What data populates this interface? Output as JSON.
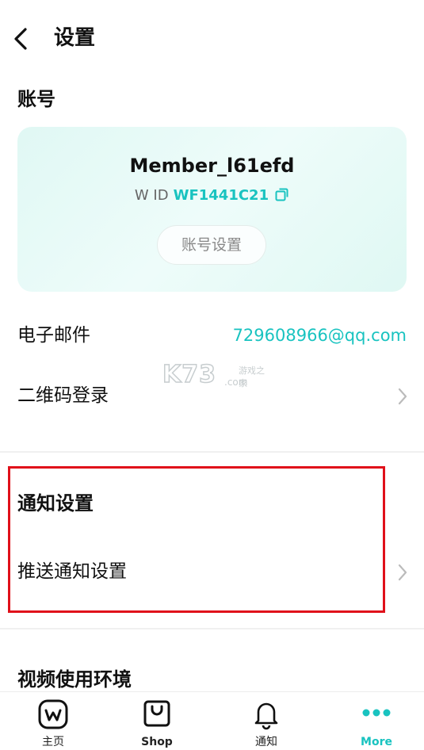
{
  "header": {
    "title": "设置"
  },
  "account": {
    "section_title": "账号",
    "member_name": "Member_l61efd",
    "wid_label": "W ID",
    "wid_value": "WF1441C21",
    "settings_button": "账号设置"
  },
  "rows": {
    "email_label": "电子邮件",
    "email_value": "729608966@qq.com",
    "qr_login_label": "二维码登录"
  },
  "notification": {
    "section_title": "通知设置",
    "push_label": "推送通知设置"
  },
  "video": {
    "section_title": "视频使用环境"
  },
  "watermark": {
    "big": "K73",
    "small": "游戏之家",
    "com": ".com"
  },
  "tabbar": {
    "items": [
      {
        "label": "主页",
        "icon": "weverse-home-icon"
      },
      {
        "label": "Shop",
        "icon": "shopping-bag-icon"
      },
      {
        "label": "通知",
        "icon": "bell-icon"
      },
      {
        "label": "More",
        "icon": "more-dots-icon"
      }
    ]
  },
  "colors": {
    "accent": "#19c3c0",
    "highlight": "#e0101a",
    "card": "#e6faf6"
  }
}
